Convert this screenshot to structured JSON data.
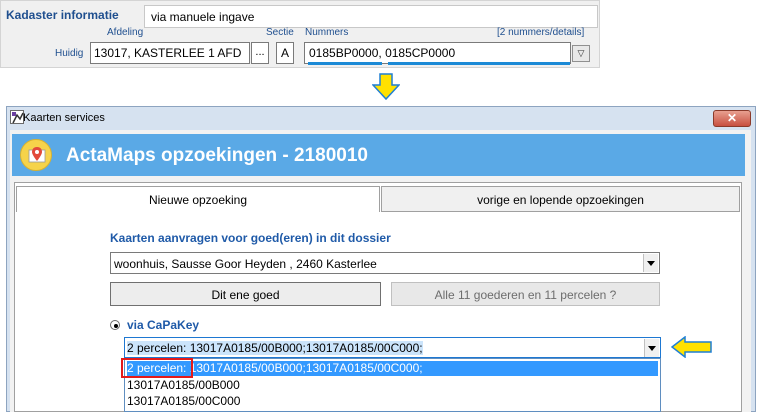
{
  "kadaster": {
    "title": "Kadaster informatie",
    "manual_value": "via manuele ingave",
    "afdeling_label": "Afdeling",
    "sectie_label": "Sectie",
    "nummers_label": "Nummers",
    "details_link": "[2 nummers/details]",
    "huidig_label": "Huidig",
    "afdeling_value": "13017, KASTERLEE  1 AFD",
    "dots_label": "...",
    "sectie_value": "A",
    "nummers_value": "0185BP0000, 0185CP0000",
    "underline_color": "#1b8ad6"
  },
  "window": {
    "title": "Kaarten services",
    "close_label": "✕",
    "banner_title": "ActaMaps opzoekingen - 2180010",
    "banner_color": "#5aa9e6",
    "tabs": [
      {
        "label": "Nieuwe opzoeking",
        "active": true
      },
      {
        "label": "vorige en lopende opzoekingen",
        "active": false
      }
    ],
    "request_label": "Kaarten aanvragen voor goed(eren) in dit dossier",
    "goed_selected": "woonhuis, Sausse Goor Heyden , 2460 Kasterlee",
    "btn_one": "Dit ene goed",
    "btn_all": "Alle 11 goederen en 11 percelen ?",
    "capakey_label": "via CaPaKey",
    "capakey_selected": "2 percelen: 13017A0185/00B000;13017A0185/00C000;",
    "capakey_options": [
      "2 percelen: 13017A0185/00B000;13017A0185/00C000;",
      "13017A0185/00B000",
      "13017A0185/00C000"
    ]
  },
  "colors": {
    "arrow_yellow": "#ffe100",
    "arrow_outline": "#1f7fd4",
    "highlight_red": "#e41a1a",
    "selection_blue": "#3399ff"
  }
}
